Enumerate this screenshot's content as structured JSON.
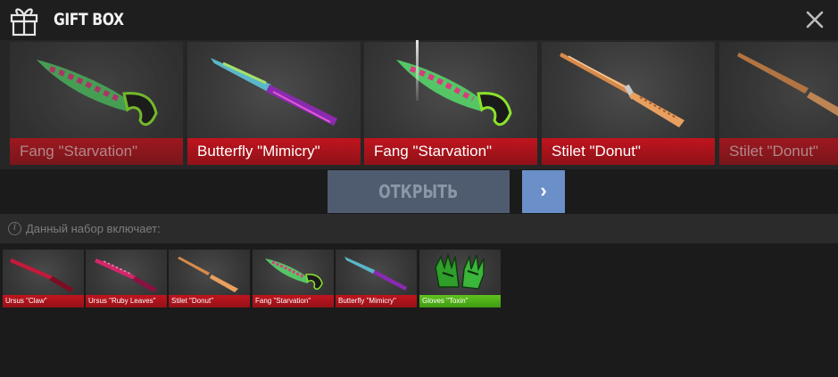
{
  "header": {
    "title": "GIFT BOX",
    "icons": {
      "gift": "gift-icon",
      "close": "close-icon"
    }
  },
  "roulette": {
    "cards": [
      {
        "label": "Fang \"Starvation\"",
        "weapon": "fang",
        "skin": "starvation",
        "rarity": "red"
      },
      {
        "label": "Butterfly \"Mimicry\"",
        "weapon": "butterfly",
        "skin": "mimicry",
        "rarity": "red"
      },
      {
        "label": "Fang \"Starvation\"",
        "weapon": "fang",
        "skin": "starvation",
        "rarity": "red"
      },
      {
        "label": "Stilet \"Donut\"",
        "weapon": "stilet",
        "skin": "donut",
        "rarity": "red"
      },
      {
        "label": "Stilet \"Donut\"",
        "weapon": "stilet",
        "skin": "donut",
        "rarity": "red"
      }
    ]
  },
  "controls": {
    "open_label": "ОТКРЫТЬ",
    "next_label": "›"
  },
  "info": {
    "text": "Данный набор включает:"
  },
  "contents": {
    "items": [
      {
        "label": "Ursus \"Claw\"",
        "rarity": "red"
      },
      {
        "label": "Ursus \"Ruby Leaves\"",
        "rarity": "red"
      },
      {
        "label": "Stilet \"Donut\"",
        "rarity": "red"
      },
      {
        "label": "Fang \"Starvation\"",
        "rarity": "red"
      },
      {
        "label": "Butterfly \"Mimicry\"",
        "rarity": "red"
      },
      {
        "label": "Gloves \"Toxin\"",
        "rarity": "green"
      }
    ]
  },
  "colors": {
    "rarity_red": "#b8141d",
    "rarity_green": "#56b81a",
    "open_button": "#4f5b6f",
    "next_button": "#6a8fc9"
  }
}
